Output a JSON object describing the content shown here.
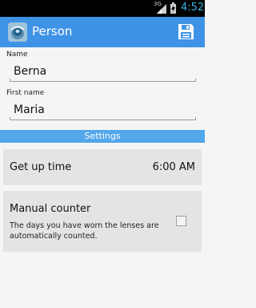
{
  "status_bar": {
    "network": "3G",
    "time": "4:52",
    "accent_color": "#33b5e5"
  },
  "action_bar": {
    "title": "Person",
    "app_icon": "lens-icon",
    "save_icon": "save-icon",
    "background": "#3f93e6"
  },
  "form": {
    "name_label": "Name",
    "name_value": "Berna",
    "first_name_label": "First name",
    "first_name_value": "Maria"
  },
  "settings": {
    "header": "Settings",
    "get_up_label": "Get up time",
    "get_up_value": "6:00 AM",
    "manual_counter_title": "Manual counter",
    "manual_counter_desc": "The days you have worn the lenses are automatically counted.",
    "manual_counter_checked": false
  }
}
